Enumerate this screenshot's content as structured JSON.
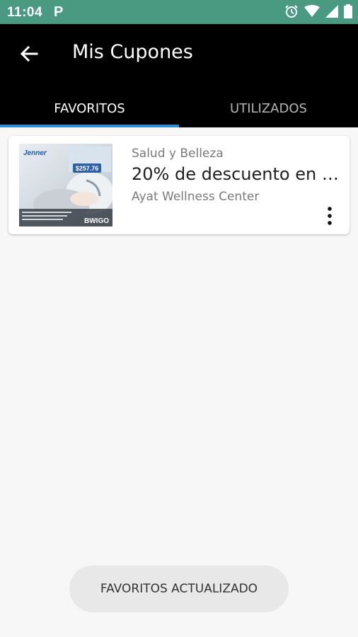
{
  "status_bar": {
    "time": "11:04",
    "notification_icon": "P",
    "icons": [
      "alarm-icon",
      "wifi-icon",
      "signal-icon",
      "battery-icon"
    ]
  },
  "app_bar": {
    "title": "Mis Cupones",
    "back_icon": "arrow-back-icon"
  },
  "tabs": [
    {
      "label": "FAVORITOS",
      "active": true
    },
    {
      "label": "UTILIZADOS",
      "active": false
    }
  ],
  "coupons": [
    {
      "category": "Salud y Belleza",
      "title": "20% de descuento en tr...",
      "merchant": "Ayat Wellness Center",
      "image": {
        "brand": "Jenner",
        "price": "$257.76",
        "footer_brand": "BWIGO"
      },
      "menu_icon": "more-vert-icon"
    }
  ],
  "toast": {
    "message": "FAVORITOS ACTUALIZADO"
  },
  "colors": {
    "status_bar": "#4a9a82",
    "app_bar": "#000000",
    "tab_indicator": "#2e8cd6",
    "background": "#f7f7f7"
  }
}
